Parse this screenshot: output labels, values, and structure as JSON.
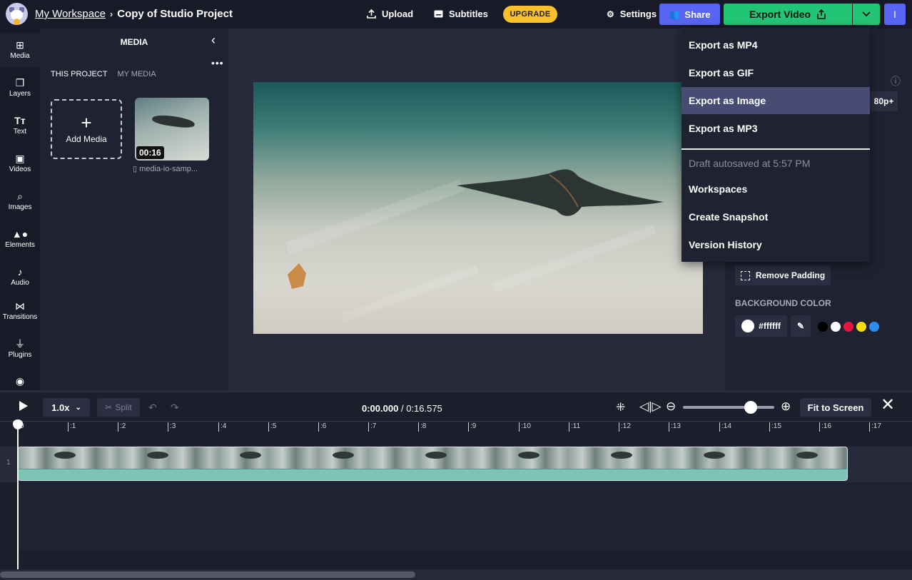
{
  "header": {
    "workspace_link": "My Workspace",
    "project_title": "Copy of Studio Project",
    "upload_label": "Upload",
    "subtitles_label": "Subtitles",
    "upgrade_label": "UPGRADE",
    "settings_label": "Settings",
    "share_label": "Share",
    "export_label": "Export Video",
    "user_initial": "I"
  },
  "sidebar": {
    "items": [
      {
        "label": "Media",
        "icon": "media-icon"
      },
      {
        "label": "Layers",
        "icon": "layers-icon"
      },
      {
        "label": "Text",
        "icon": "text-icon"
      },
      {
        "label": "Videos",
        "icon": "videos-icon"
      },
      {
        "label": "Images",
        "icon": "images-icon"
      },
      {
        "label": "Elements",
        "icon": "elements-icon"
      },
      {
        "label": "Audio",
        "icon": "audio-icon"
      },
      {
        "label": "Transitions",
        "icon": "transitions-icon"
      },
      {
        "label": "Plugins",
        "icon": "plugins-icon"
      }
    ]
  },
  "media_panel": {
    "title": "MEDIA",
    "tab_this_project": "THIS PROJECT",
    "tab_my_media": "MY MEDIA",
    "add_media_label": "Add Media",
    "item": {
      "duration": "00:16",
      "name": "media-io-samp..."
    }
  },
  "right_panel": {
    "resolution_text": "80p+",
    "remove_padding_label": "Remove Padding",
    "background_color_label": "BACKGROUND COLOR",
    "color_value": "#ffffff",
    "swatch_colors": [
      "#000000",
      "#ffffff",
      "#e8163c",
      "#f8d90f",
      "#2a8ff0"
    ]
  },
  "export_menu": {
    "items": [
      "Export as MP4",
      "Export as GIF",
      "Export as Image",
      "Export as MP3"
    ],
    "highlighted": "Export as Image",
    "autosave_note": "Draft autosaved at 5:57 PM",
    "more_items": [
      "Workspaces",
      "Create Snapshot",
      "Version History"
    ]
  },
  "timeline": {
    "speed": "1.0x",
    "split_label": "Split",
    "current_time": "0:00.000",
    "total_time": "0:16.575",
    "fit_label": "Fit to Screen",
    "zoom_level": 0.73,
    "track_number": "1",
    "ruler_ticks": [
      "0",
      ":1",
      ":2",
      ":3",
      ":4",
      ":5",
      ":6",
      ":7",
      ":8",
      ":9",
      ":10",
      ":11",
      ":12",
      ":13",
      ":14",
      ":15",
      ":16",
      ":17"
    ]
  },
  "colors": {
    "accent_blue": "#5765f2",
    "export_green": "#22c475",
    "upgrade_yellow": "#f8c12a",
    "menu_highlight": "#464c72"
  }
}
